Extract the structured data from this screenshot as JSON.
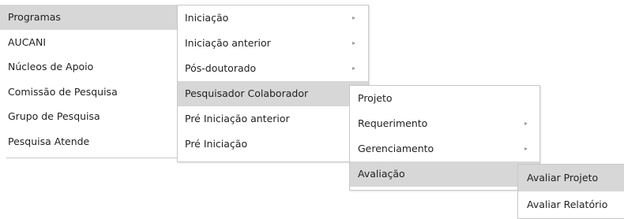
{
  "menu_level1": {
    "items": [
      {
        "label": "Programas"
      },
      {
        "label": "AUCANI"
      },
      {
        "label": "Núcleos de Apoio"
      },
      {
        "label": "Comissão de Pesquisa"
      },
      {
        "label": "Grupo de Pesquisa"
      },
      {
        "label": "Pesquisa Atende"
      }
    ]
  },
  "menu_level2": {
    "items": [
      {
        "label": "Iniciação"
      },
      {
        "label": "Iniciação anterior"
      },
      {
        "label": "Pós-doutorado"
      },
      {
        "label": "Pesquisador Colaborador"
      },
      {
        "label": "Pré Iniciação anterior"
      },
      {
        "label": "Pré Iniciação"
      }
    ]
  },
  "menu_level3": {
    "items": [
      {
        "label": "Projeto"
      },
      {
        "label": "Requerimento"
      },
      {
        "label": "Gerenciamento"
      },
      {
        "label": "Avaliação"
      }
    ]
  },
  "menu_level4": {
    "items": [
      {
        "label": "Avaliar Projeto"
      },
      {
        "label": "Avaliar Relatório"
      }
    ]
  },
  "icons": {
    "submenu_arrow": "▸"
  },
  "colors": {
    "active_bg": "#d7d7d7",
    "border": "#c8c8c8",
    "text": "#222222",
    "arrow": "#9a9a9a"
  }
}
